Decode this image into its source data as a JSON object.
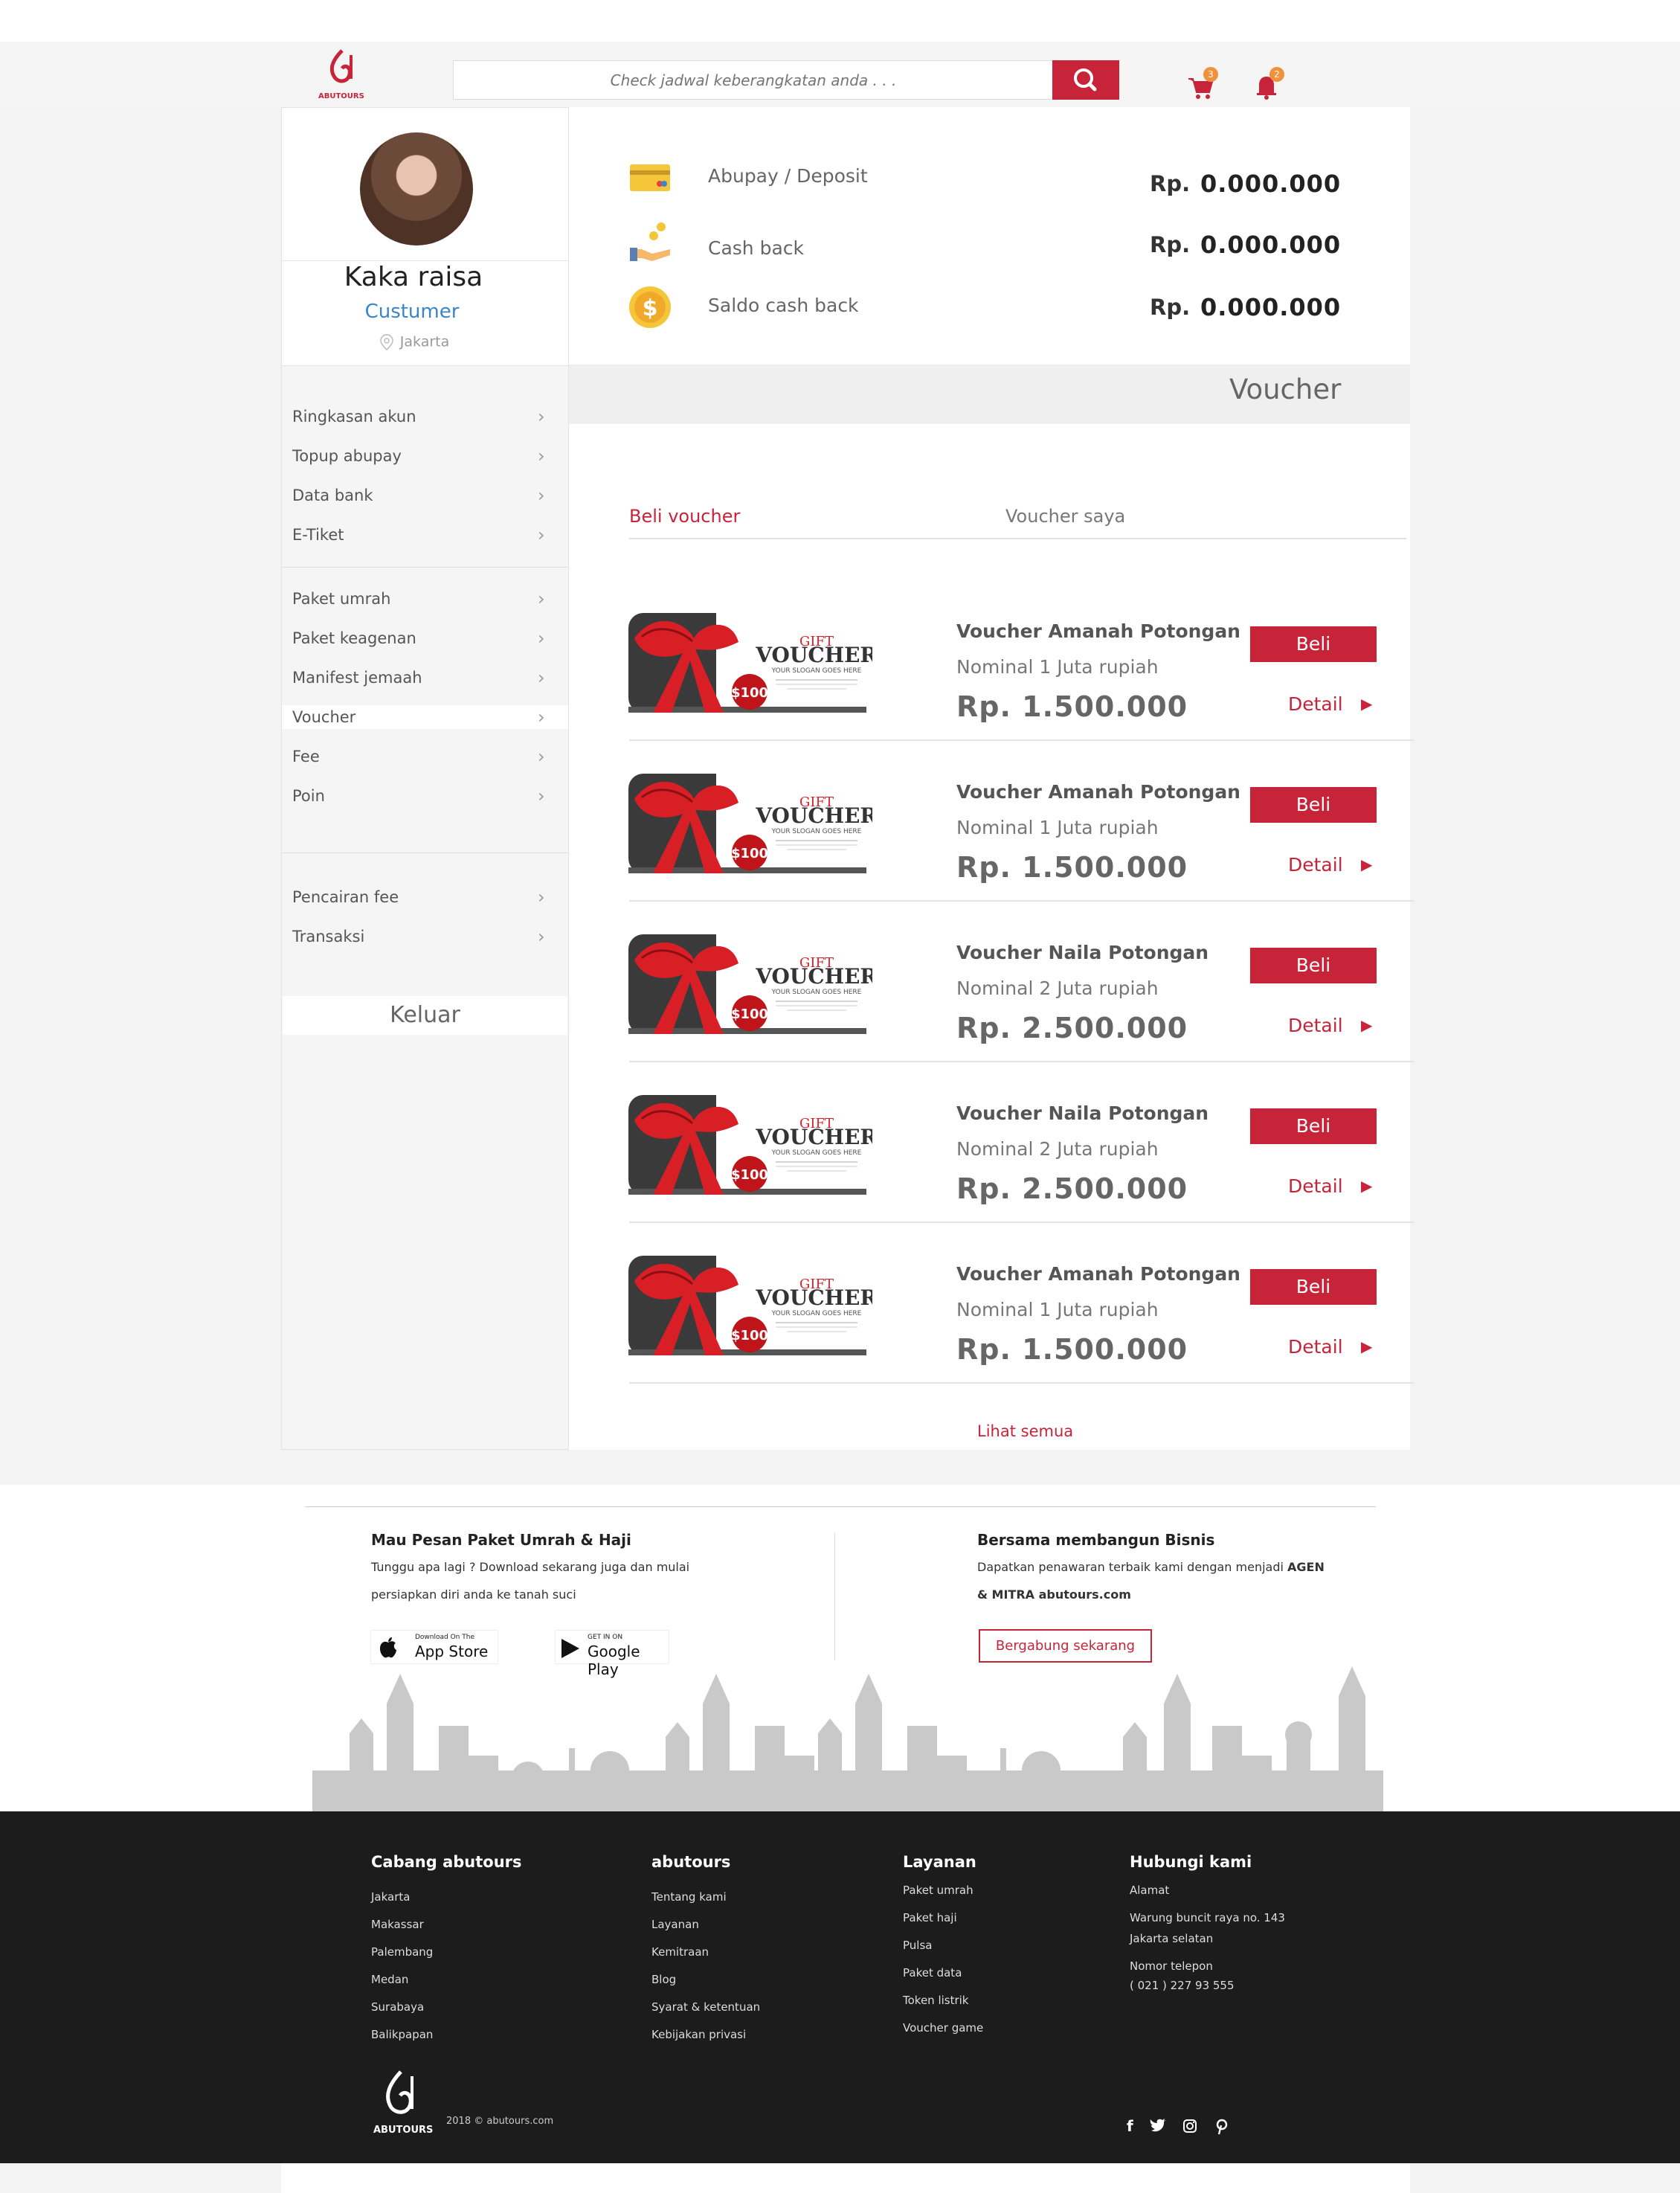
{
  "colors": {
    "accent": "#c7243a",
    "link_blue": "#3a86c8",
    "badge": "#f0913b",
    "footer_bg": "#1c1c1c"
  },
  "header": {
    "brand": "ABUTOURS",
    "search_placeholder": "Check jadwal keberangkatan anda . . .",
    "cart_count": "3",
    "notification_count": "2"
  },
  "profile": {
    "name": "Kaka raisa",
    "role": "Custumer",
    "city": "Jakarta"
  },
  "sidebar": {
    "group1": [
      "Ringkasan akun",
      "Topup abupay",
      "Data bank",
      "E-Tiket"
    ],
    "group2": [
      "Paket umrah",
      "Paket keagenan",
      "Manifest jemaah",
      "Voucher",
      "Fee",
      "Poin"
    ],
    "group3": [
      "Pencairan fee",
      "Transaksi"
    ],
    "active": "Voucher",
    "logout": "Keluar"
  },
  "wallet": [
    {
      "icon": "credit-card-icon",
      "label": "Abupay / Deposit",
      "currency": "Rp.",
      "value": "0.000.000"
    },
    {
      "icon": "cashback-hand-icon",
      "label": "Cash back",
      "currency": "Rp.",
      "value": "0.000.000"
    },
    {
      "icon": "coin-dollar-icon",
      "label": "Saldo cash back",
      "currency": "Rp.",
      "value": "0.000.000"
    }
  ],
  "section_title": "Voucher",
  "tabs": {
    "active": "Beli voucher",
    "other": "Voucher saya"
  },
  "voucher_image": {
    "gift": "GIFT",
    "voucher": "VOUCHER",
    "slogan": "YOUR SLOGAN GOES HERE",
    "amount": "$100"
  },
  "vouchers": [
    {
      "title": "Voucher Amanah Potongan",
      "nominal": "Nominal 1 Juta rupiah",
      "price": "Rp. 1.500.000",
      "buy": "Beli",
      "detail": "Detail"
    },
    {
      "title": "Voucher Amanah Potongan",
      "nominal": "Nominal 1 Juta rupiah",
      "price": "Rp. 1.500.000",
      "buy": "Beli",
      "detail": "Detail"
    },
    {
      "title": "Voucher Naila Potongan",
      "nominal": "Nominal 2 Juta rupiah",
      "price": "Rp. 2.500.000",
      "buy": "Beli",
      "detail": "Detail"
    },
    {
      "title": "Voucher Naila Potongan",
      "nominal": "Nominal 2 Juta rupiah",
      "price": "Rp. 2.500.000",
      "buy": "Beli",
      "detail": "Detail"
    },
    {
      "title": "Voucher Amanah Potongan",
      "nominal": "Nominal 1 Juta rupiah",
      "price": "Rp. 1.500.000",
      "buy": "Beli",
      "detail": "Detail"
    }
  ],
  "see_all": "Lihat semua",
  "promo": {
    "left_title": "Mau Pesan Paket Umrah & Haji",
    "left_line1": "Tunggu apa lagi ? Download sekarang juga dan mulai",
    "left_line2": "persiapkan diri anda ke tanah suci",
    "appstore_small": "Download On The",
    "appstore_big": "App Store",
    "gplay_small": "GET IN ON",
    "gplay_big": "Google Play",
    "right_title": "Bersama membangun Bisnis",
    "right_line1": "Dapatkan penawaran terbaik kami dengan menjadi",
    "right_bold1": "AGEN",
    "right_line2": "& MITRA abutours.com",
    "join_button": "Bergabung sekarang"
  },
  "footer": {
    "col1": {
      "title": "Cabang abutours",
      "items": [
        "Jakarta",
        "Makassar",
        "Palembang",
        "Medan",
        "Surabaya",
        "Balikpapan"
      ]
    },
    "col2": {
      "title": "abutours",
      "items": [
        "Tentang kami",
        "Layanan",
        "Kemitraan",
        "Blog",
        "Syarat & ketentuan",
        "Kebijakan privasi"
      ]
    },
    "col3": {
      "title": "Layanan",
      "items": [
        "Paket umrah",
        "Paket haji",
        "Pulsa",
        "Paket data",
        "Token listrik",
        "Voucher game"
      ]
    },
    "col4": {
      "title": "Hubungi kami",
      "address_label": "Alamat",
      "address1": "Warung buncit raya no. 143",
      "address2": "Jakarta selatan",
      "phone_label": "Nomor telepon",
      "phone": "( 021 )  227 93 555"
    },
    "copyright": "2018 © abutours.com",
    "social": [
      "f",
      "t",
      "ig",
      "p"
    ]
  }
}
